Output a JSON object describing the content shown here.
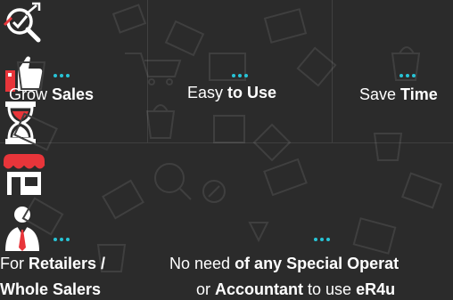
{
  "features": [
    {
      "id": "grow-sales",
      "label_normal": "Grow ",
      "label_bold": "Sales",
      "icon": "magnifier-chart-icon"
    },
    {
      "id": "easy-to-use",
      "label_normal": "Easy ",
      "label_bold": "to Use",
      "icon": "thumbs-up-icon"
    },
    {
      "id": "save-time",
      "label_normal": "Save ",
      "label_bold": "Time",
      "icon": "hourglass-icon"
    },
    {
      "id": "retailers",
      "line1_normal": "For ",
      "line1_bold": "Retailers /",
      "line2_bold": "Whole Salers",
      "icon": "storefront-icon"
    },
    {
      "id": "no-special-operator",
      "line1_normal": "No need ",
      "line1_bold": "of any Special Operat",
      "line2_normal_a": "or ",
      "line2_bold_a": "Accountant",
      "line2_normal_b": " to use ",
      "line2_bold_b": "eR4u",
      "icon": "businessman-icon"
    }
  ],
  "colors": {
    "background": "#2b2b2b",
    "accent_red": "#e8353a",
    "dots_cyan": "#27c4d6",
    "text": "#ffffff"
  }
}
